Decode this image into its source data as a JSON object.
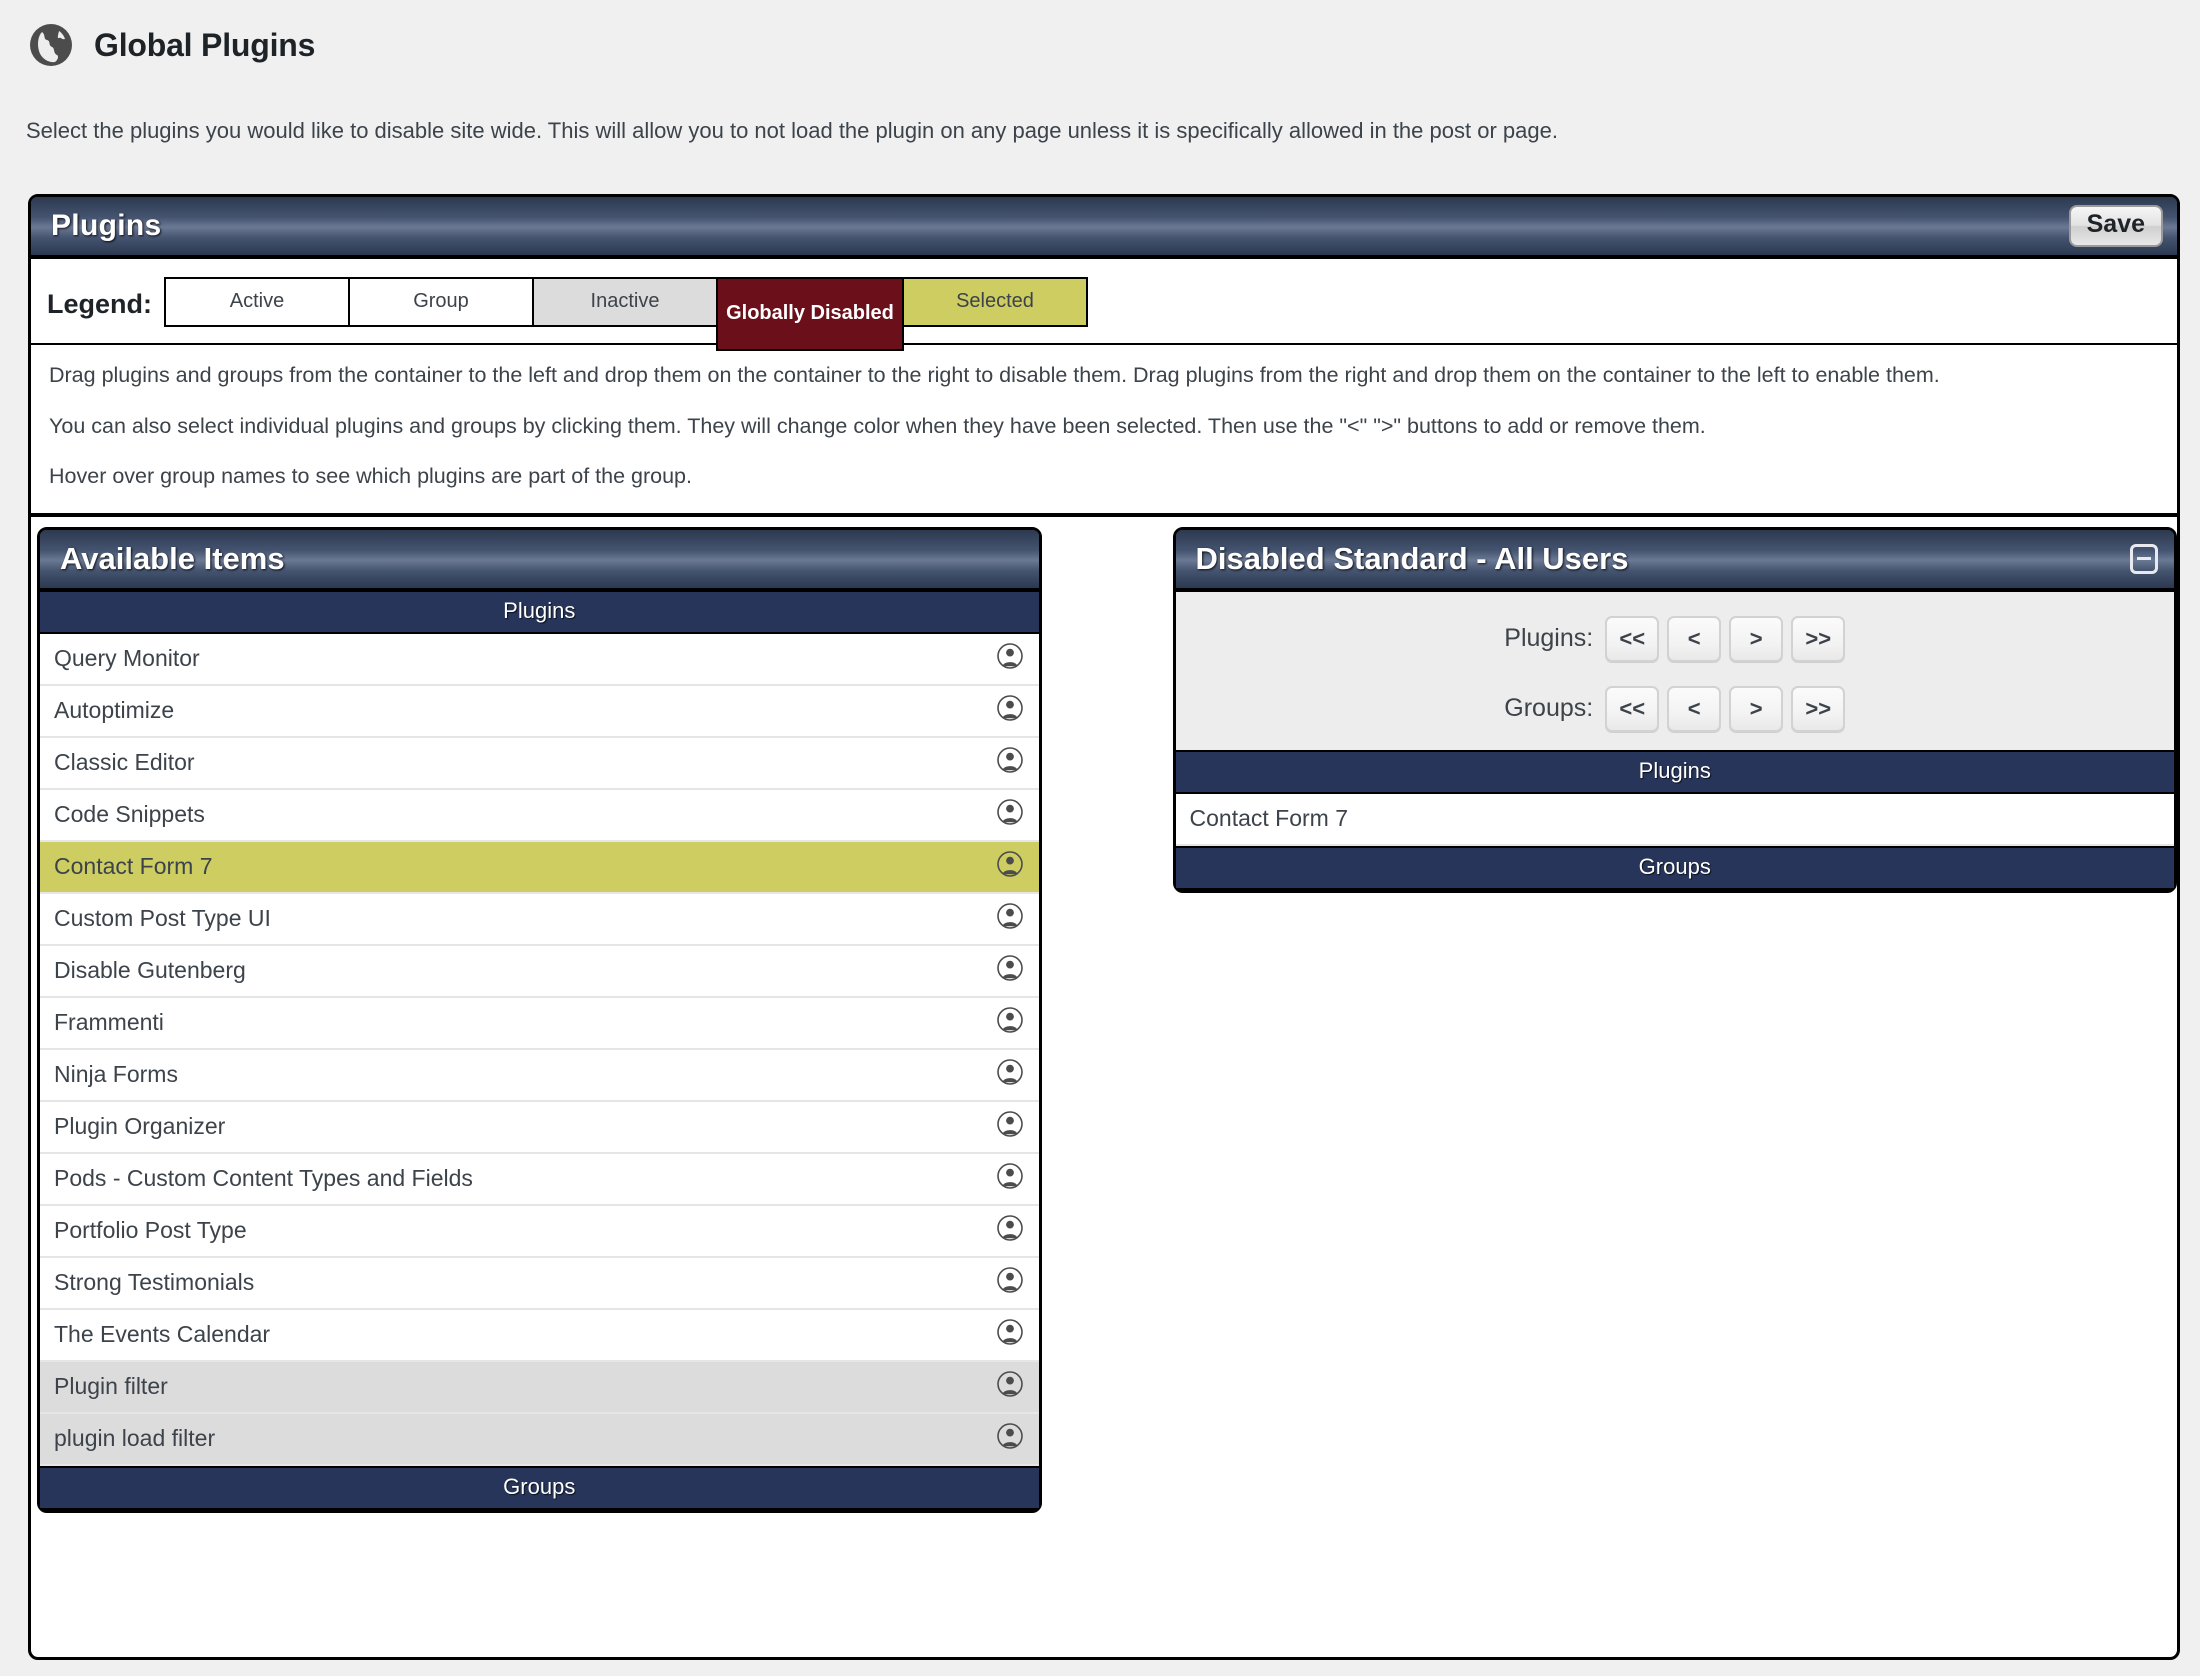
{
  "header": {
    "icon": "globe-icon",
    "title": "Global Plugins",
    "description": "Select the plugins you would like to disable site wide. This will allow you to not load the plugin on any page unless it is specifically allowed in the post or page."
  },
  "plugins_panel": {
    "title": "Plugins",
    "save_label": "Save",
    "legend": {
      "label": "Legend:",
      "items": [
        {
          "label": "Active",
          "color": "#ffffff"
        },
        {
          "label": "Group",
          "color": "#ffffff"
        },
        {
          "label": "Inactive",
          "color": "#dcdcdc"
        },
        {
          "label": "Globally Disabled",
          "color": "#6b0f1a"
        },
        {
          "label": "Selected",
          "color": "#cdcd62"
        }
      ]
    },
    "instructions": [
      "Drag plugins and groups from the container to the left and drop them on the container to the right to disable them. Drag plugins from the right and drop them on the container to the left to enable them.",
      "You can also select individual plugins and groups by clicking them. They will change color when they have been selected. Then use the \"<\" \">\" buttons to add or remove them.",
      "Hover over group names to see which plugins are part of the group."
    ]
  },
  "available_items": {
    "title": "Available Items",
    "plugins_header": "Plugins",
    "groups_header": "Groups",
    "plugins": [
      {
        "name": "Query Monitor",
        "state": "active",
        "icon": "user-icon"
      },
      {
        "name": "Autoptimize",
        "state": "active",
        "icon": "user-icon"
      },
      {
        "name": "Classic Editor",
        "state": "active",
        "icon": "user-icon"
      },
      {
        "name": "Code Snippets",
        "state": "active",
        "icon": "user-icon"
      },
      {
        "name": "Contact Form 7",
        "state": "selected",
        "icon": "user-icon"
      },
      {
        "name": "Custom Post Type UI",
        "state": "active",
        "icon": "user-icon"
      },
      {
        "name": "Disable Gutenberg",
        "state": "active",
        "icon": "user-icon"
      },
      {
        "name": "Frammenti",
        "state": "active",
        "icon": "user-icon"
      },
      {
        "name": "Ninja Forms",
        "state": "active",
        "icon": "user-icon"
      },
      {
        "name": "Plugin Organizer",
        "state": "active",
        "icon": "user-icon"
      },
      {
        "name": "Pods - Custom Content Types and Fields",
        "state": "active",
        "icon": "user-icon"
      },
      {
        "name": "Portfolio Post Type",
        "state": "active",
        "icon": "user-icon"
      },
      {
        "name": "Strong Testimonials",
        "state": "active",
        "icon": "user-icon"
      },
      {
        "name": "The Events Calendar",
        "state": "active",
        "icon": "user-icon"
      },
      {
        "name": "Plugin filter",
        "state": "inactive",
        "icon": "user-icon"
      },
      {
        "name": "plugin load filter",
        "state": "inactive",
        "icon": "user-icon"
      }
    ],
    "groups": []
  },
  "disabled_panel": {
    "title": "Disabled Standard - All Users",
    "collapse_icon": "minus-icon",
    "plugins_move_label": "Plugins:",
    "groups_move_label": "Groups:",
    "move_buttons": [
      "<<",
      "<",
      ">",
      ">>"
    ],
    "plugins_header": "Plugins",
    "groups_header": "Groups",
    "plugins": [
      {
        "name": "Contact Form 7",
        "state": "active"
      }
    ],
    "groups": []
  }
}
